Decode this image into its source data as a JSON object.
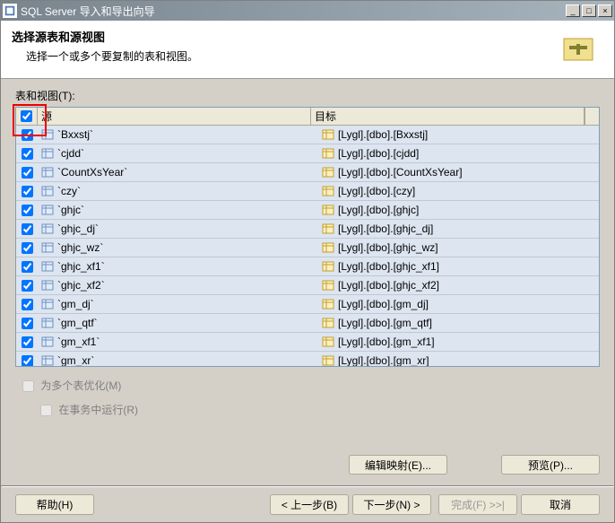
{
  "window": {
    "title": "SQL Server 导入和导出向导"
  },
  "header": {
    "title": "选择源表和源视图",
    "subtitle": "选择一个或多个要复制的表和视图。"
  },
  "table": {
    "label": "表和视图(T):",
    "col_source": "源",
    "col_target": "目标"
  },
  "rows": [
    {
      "checked": true,
      "source": "`Bxxstj`",
      "target": "[Lygl].[dbo].[Bxxstj]"
    },
    {
      "checked": true,
      "source": "`cjdd`",
      "target": "[Lygl].[dbo].[cjdd]"
    },
    {
      "checked": true,
      "source": "`CountXsYear`",
      "target": "[Lygl].[dbo].[CountXsYear]"
    },
    {
      "checked": true,
      "source": "`czy`",
      "target": "[Lygl].[dbo].[czy]"
    },
    {
      "checked": true,
      "source": "`ghjc`",
      "target": "[Lygl].[dbo].[ghjc]"
    },
    {
      "checked": true,
      "source": "`ghjc_dj`",
      "target": "[Lygl].[dbo].[ghjc_dj]"
    },
    {
      "checked": true,
      "source": "`ghjc_wz`",
      "target": "[Lygl].[dbo].[ghjc_wz]"
    },
    {
      "checked": true,
      "source": "`ghjc_xf1`",
      "target": "[Lygl].[dbo].[ghjc_xf1]"
    },
    {
      "checked": true,
      "source": "`ghjc_xf2`",
      "target": "[Lygl].[dbo].[ghjc_xf2]"
    },
    {
      "checked": true,
      "source": "`gm_dj`",
      "target": "[Lygl].[dbo].[gm_dj]"
    },
    {
      "checked": true,
      "source": "`gm_qtf`",
      "target": "[Lygl].[dbo].[gm_qtf]"
    },
    {
      "checked": true,
      "source": "`gm_xf1`",
      "target": "[Lygl].[dbo].[gm_xf1]"
    },
    {
      "checked": true,
      "source": "`gm_xr`",
      "target": "[Lygl].[dbo].[gm_xr]"
    }
  ],
  "options": {
    "optimize": "为多个表优化(M)",
    "transaction": "在事务中运行(R)"
  },
  "buttons": {
    "edit_mapping": "编辑映射(E)...",
    "preview": "预览(P)...",
    "help": "帮助(H)",
    "back": "< 上一步(B)",
    "next": "下一步(N) >",
    "finish": "完成(F) >>|",
    "cancel": "取消"
  }
}
